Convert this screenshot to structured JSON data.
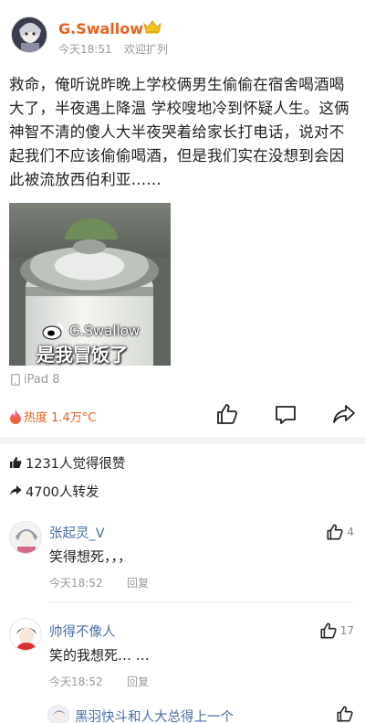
{
  "post": {
    "author": "G.Swallow",
    "time": "今天18:51",
    "source": "欢迎扩列",
    "text": "救命，俺听说昨晚上学校俩男生偷偷在宿舍喝酒喝大了，半夜遇上降温 学校嗖地冷到怀疑人生。这俩神智不清的傻人大半夜哭着给家长打电话，说对不起我们不应该偷偷喝酒，但是我们实在没想到会因此被流放西伯利亚……",
    "image": {
      "watermark": "G.Swallow",
      "caption": "是我冒饭了"
    },
    "device": "iPad 8",
    "heat_label": "热度 1.4万°C",
    "icons": [
      "like-icon",
      "comment-icon",
      "share-icon"
    ]
  },
  "stats": {
    "likes_text": "1231人觉得很赞",
    "reposts_text": "4700人转发"
  },
  "comments": [
    {
      "name": "张起灵_V",
      "text": "笑得想死，，，",
      "time": "今天18:52",
      "reply": "回复",
      "likes": "4"
    },
    {
      "name": "帅得不像人",
      "text": "笑的我想死… …",
      "time": "今天18:52",
      "reply": "回复",
      "likes": "17"
    },
    {
      "name": "黑羽快斗和人大总得上一个",
      "text": "",
      "time": "",
      "reply": "",
      "likes": ""
    }
  ],
  "colors": {
    "accent": "#e8611d",
    "name_link": "#4a6ea9",
    "muted": "#9a9a9a"
  }
}
